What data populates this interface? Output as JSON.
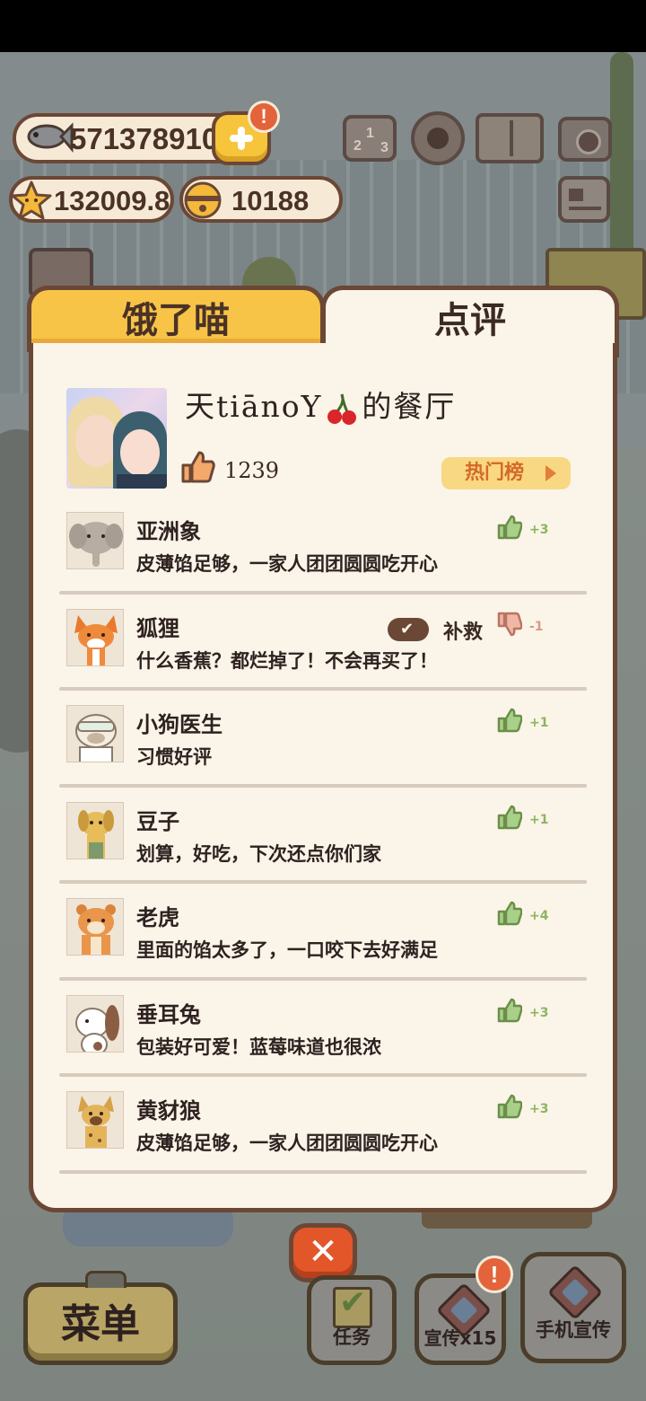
{
  "hud": {
    "fish": "571378910",
    "stars": "132009.8",
    "coins": "10188",
    "plus_badge": "!"
  },
  "tabs": {
    "hungry": "饿了喵",
    "review": "点评"
  },
  "profile": {
    "name_before": "天tiānoY",
    "name_after": "的餐厅",
    "likes": "1239",
    "hot_list": "热门榜"
  },
  "reviews": [
    {
      "name": "亚洲象",
      "comment": "皮薄馅足够，一家人团团圆圆吃开心",
      "score": "+3",
      "positive": true
    },
    {
      "name": "狐狸",
      "comment": "什么香蕉？都烂掉了！不会再买了！",
      "score": "-1",
      "positive": false,
      "rescue": "补救"
    },
    {
      "name": "小狗医生",
      "comment": "习惯好评",
      "score": "+1",
      "positive": true
    },
    {
      "name": "豆子",
      "comment": "划算，好吃，下次还点你们家",
      "score": "+1",
      "positive": true
    },
    {
      "name": "老虎",
      "comment": "里面的馅太多了，一口咬下去好满足",
      "score": "+4",
      "positive": true
    },
    {
      "name": "垂耳兔",
      "comment": "包装好可爱！蓝莓味道也很浓",
      "score": "+3",
      "positive": true
    },
    {
      "name": "黄豺狼",
      "comment": "皮薄馅足够，一家人团团圆圆吃开心",
      "score": "+3",
      "positive": true
    }
  ],
  "bottom": {
    "menu": "菜单",
    "task": "任务",
    "promo": "宣传x15",
    "promo_badge": "!",
    "phone_promo": "手机宣传",
    "close": "✕"
  },
  "colors": {
    "panel_bg": "#fbf4e8",
    "border": "#6b4736",
    "tab_active": "#f8c448",
    "positive": "#8bb562",
    "negative": "#d89a86",
    "close": "#e2562a"
  }
}
